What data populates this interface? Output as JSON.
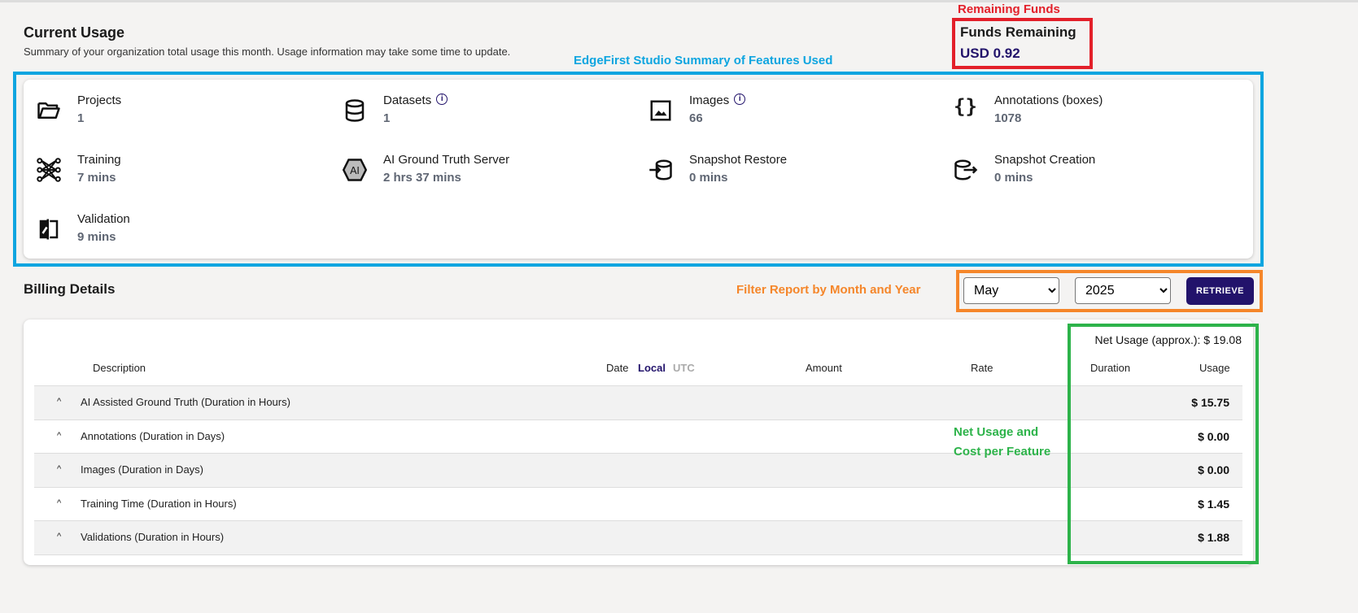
{
  "header": {
    "title": "Current Usage",
    "subtitle": "Summary of your organization total usage this month. Usage information may take some time to update."
  },
  "funds": {
    "label": "Funds Remaining",
    "value": "USD 0.92"
  },
  "annotations": {
    "funds": "Remaining Funds",
    "summary": "EdgeFirst Studio Summary of Features Used",
    "filter": "Filter Report by Month and Year",
    "net_line1": "Net Usage and",
    "net_line2": "Cost per Feature",
    "colors": {
      "funds": "#e3202a",
      "summary": "#0ea5e0",
      "filter": "#f5862a",
      "net": "#2db34a"
    }
  },
  "features": [
    {
      "label": "Projects",
      "value": "1",
      "icon": "folder-icon"
    },
    {
      "label": "Datasets",
      "value": "1",
      "icon": "database-icon",
      "info": "i"
    },
    {
      "label": "Images",
      "value": "66",
      "icon": "image-icon",
      "info": "i"
    },
    {
      "label": "Annotations (boxes)",
      "value": "1078",
      "icon": "braces-icon"
    },
    {
      "label": "Training",
      "value": "7 mins",
      "icon": "network-icon"
    },
    {
      "label": "AI Ground Truth Server",
      "value": "2 hrs 37 mins",
      "icon": "ai-hexagon-icon",
      "icon_text": "AI"
    },
    {
      "label": "Snapshot Restore",
      "value": "0 mins",
      "icon": "database-import-icon"
    },
    {
      "label": "Snapshot Creation",
      "value": "0 mins",
      "icon": "database-export-icon"
    },
    {
      "label": "Validation",
      "value": "9 mins",
      "icon": "compare-icon"
    }
  ],
  "billing": {
    "title": "Billing Details",
    "month": "May",
    "year": "2025",
    "retrieve": "RETRIEVE",
    "net_usage": "Net Usage (approx.): $ 19.08",
    "columns": {
      "description": "Description",
      "date": "Date",
      "local": "Local",
      "utc": "UTC",
      "amount": "Amount",
      "rate": "Rate",
      "duration": "Duration",
      "usage": "Usage"
    },
    "rows": [
      {
        "description": "AI Assisted Ground Truth (Duration in Hours)",
        "usage": "$ 15.75"
      },
      {
        "description": "Annotations (Duration in Days)",
        "usage": "$ 0.00"
      },
      {
        "description": "Images (Duration in Days)",
        "usage": "$ 0.00"
      },
      {
        "description": "Training Time (Duration in Hours)",
        "usage": "$ 1.45"
      },
      {
        "description": "Validations (Duration in Hours)",
        "usage": "$ 1.88"
      }
    ]
  }
}
